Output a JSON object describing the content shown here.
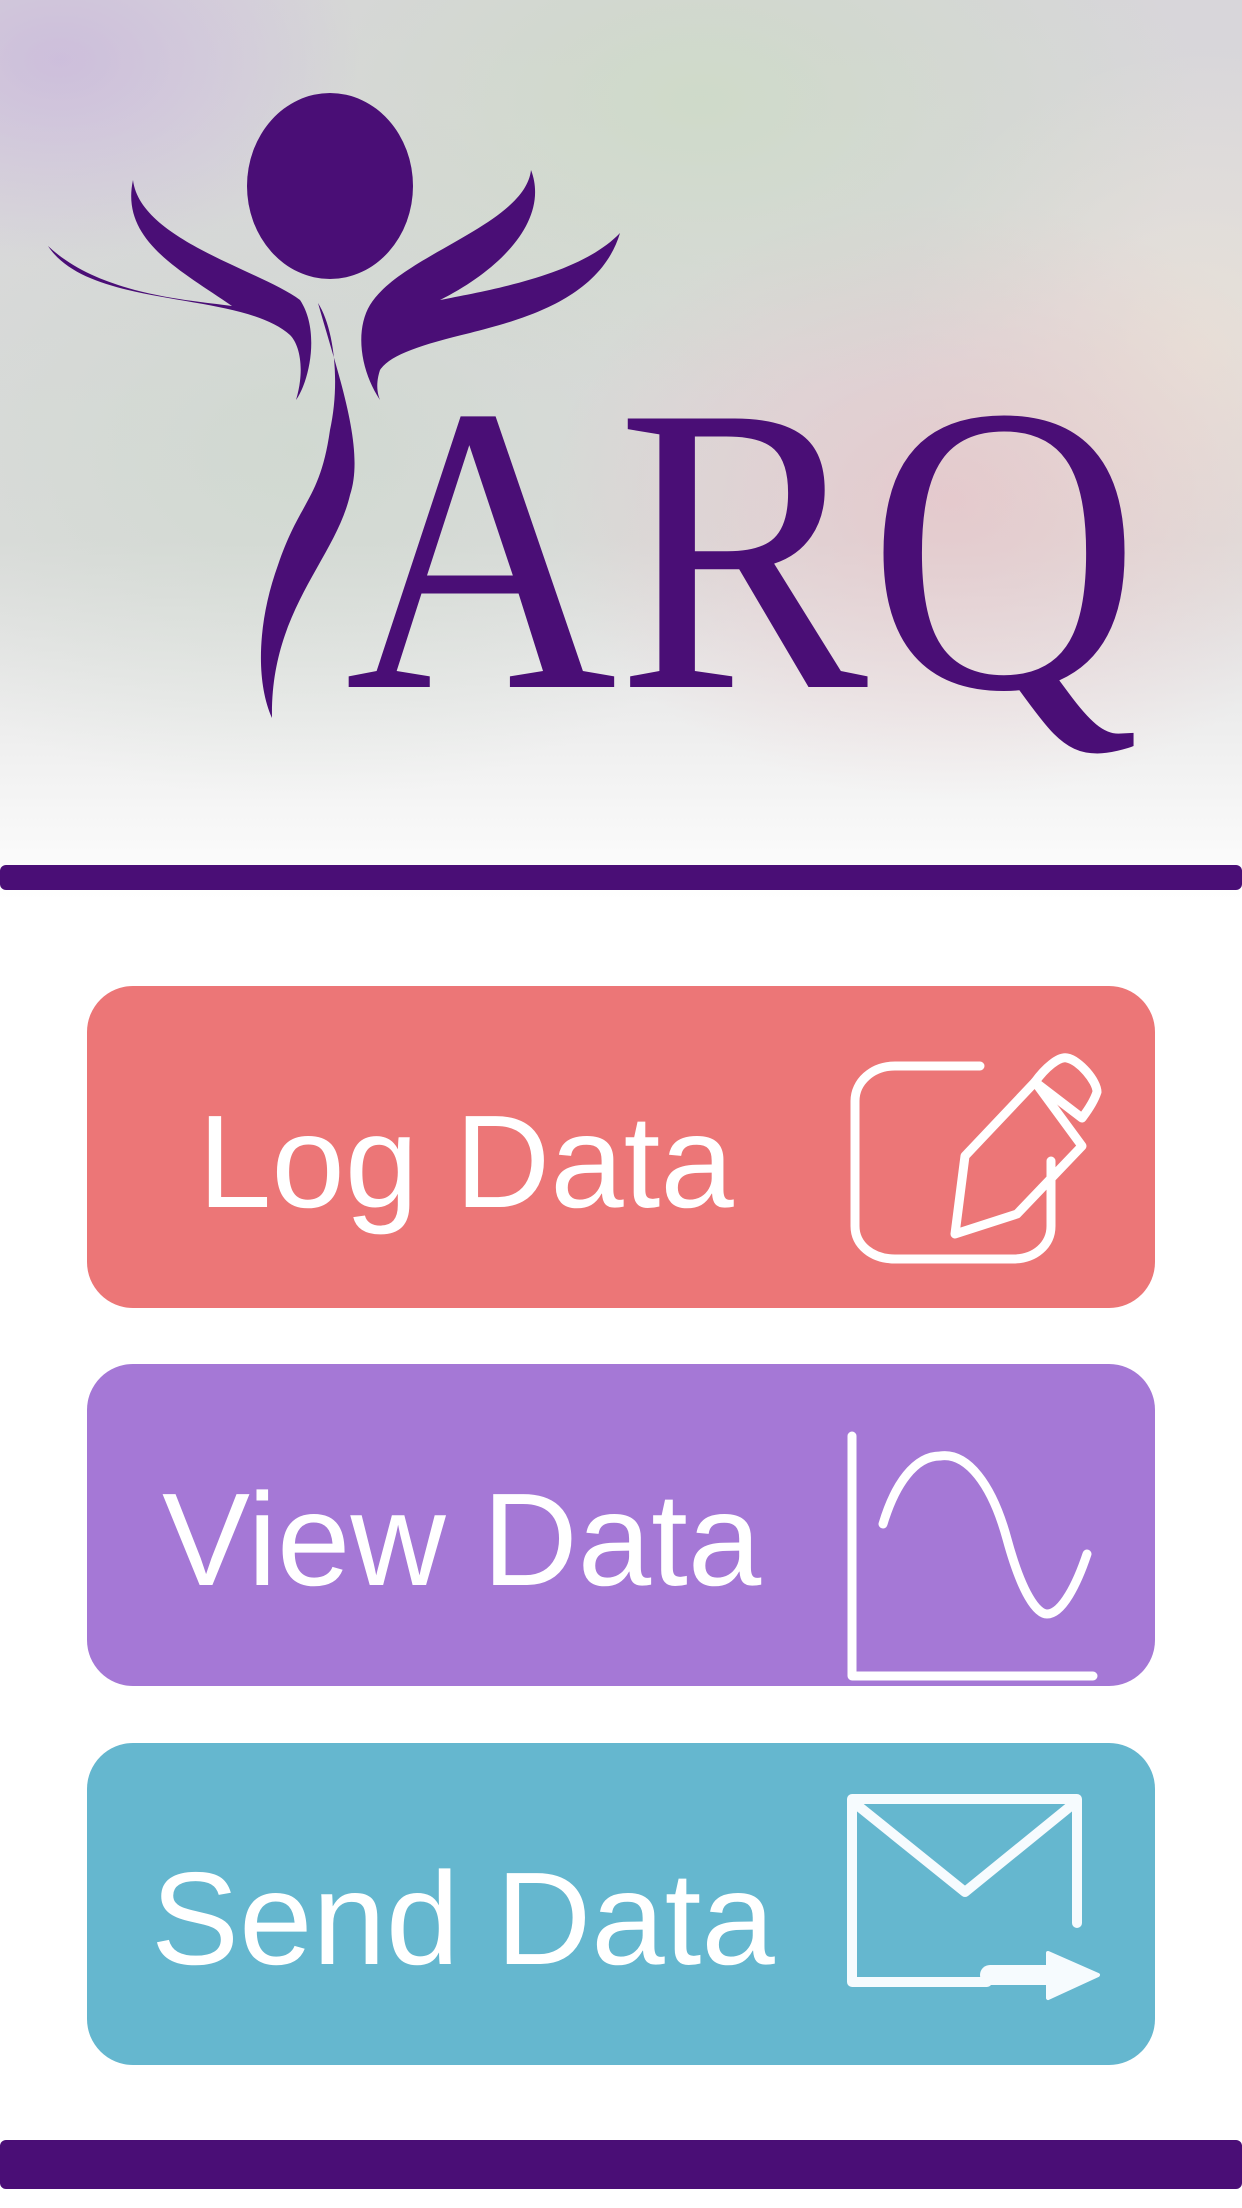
{
  "logo": {
    "text": "ARQ"
  },
  "colors": {
    "brand": "#4a0e76",
    "log": "#ec7677",
    "view": "#a578d6",
    "send": "#65b7cf"
  },
  "buttons": [
    {
      "label": "Log Data",
      "icon": "pencil-square-icon"
    },
    {
      "label": "View Data",
      "icon": "line-chart-icon"
    },
    {
      "label": "Send Data",
      "icon": "envelope-send-icon"
    }
  ]
}
